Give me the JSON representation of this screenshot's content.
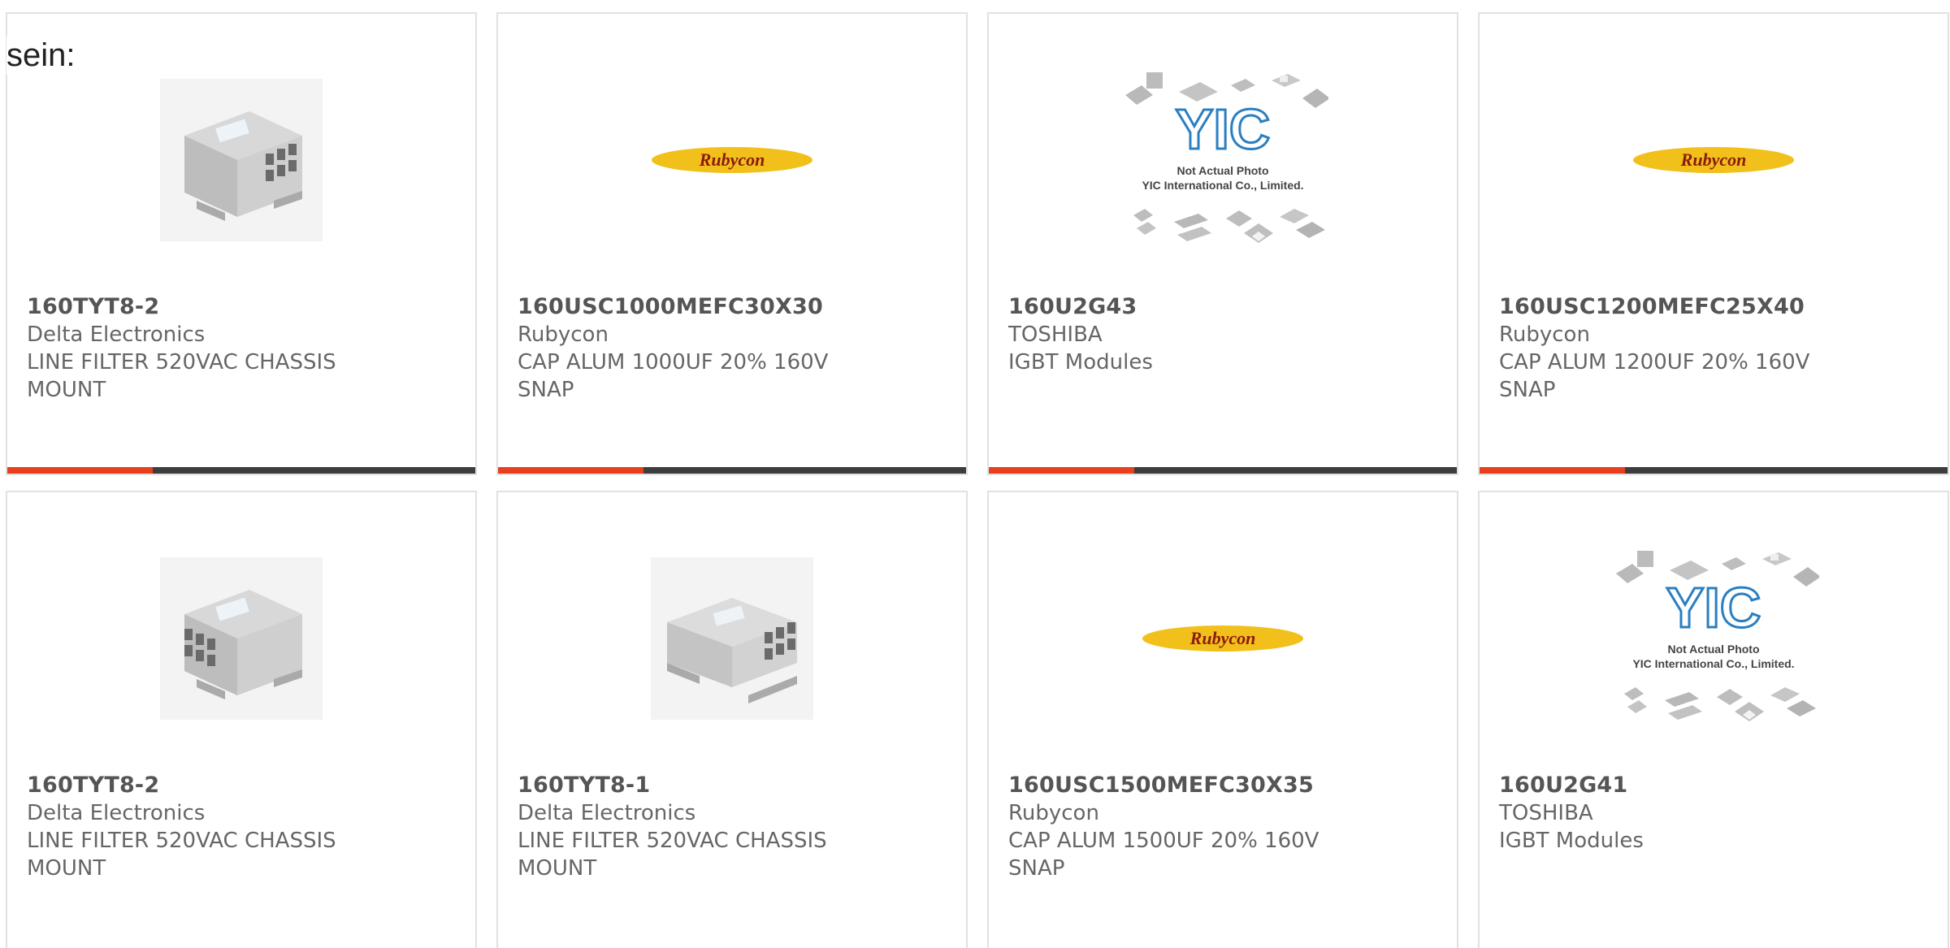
{
  "lead_text": "sein:",
  "colors": {
    "accent": "#e8401c",
    "track": "#3d3d3d",
    "logo_yellow": "#f2c01b",
    "logo_text": "#8a1a10",
    "yic_blue": "#2a7fc1"
  },
  "products": [
    {
      "part_number": "160TYT8-2",
      "manufacturer": "Delta Electronics",
      "description": "LINE FILTER 520VAC CHASSIS MOUNT",
      "image": "line-filter-photo",
      "progress": 0.31
    },
    {
      "part_number": "160USC1000MEFC30X30",
      "manufacturer": "Rubycon",
      "description": "CAP ALUM 1000UF 20% 160V SNAP",
      "image": "rubycon-logo",
      "progress": 0.31
    },
    {
      "part_number": "160U2G43",
      "manufacturer": "TOSHIBA",
      "description": "IGBT Modules",
      "image": "yic-placeholder",
      "progress": 0.31
    },
    {
      "part_number": "160USC1200MEFC25X40",
      "manufacturer": "Rubycon",
      "description": "CAP ALUM 1200UF 20% 160V SNAP",
      "image": "rubycon-logo",
      "progress": 0.31
    },
    {
      "part_number": "160TYT8-2",
      "manufacturer": "Delta Electronics",
      "description": "LINE FILTER 520VAC CHASSIS MOUNT",
      "image": "line-filter-photo"
    },
    {
      "part_number": "160TYT8-1",
      "manufacturer": "Delta Electronics",
      "description": "LINE FILTER 520VAC CHASSIS MOUNT",
      "image": "line-filter-photo"
    },
    {
      "part_number": "160USC1500MEFC30X35",
      "manufacturer": "Rubycon",
      "description": "CAP ALUM 1500UF 20% 160V SNAP",
      "image": "rubycon-logo"
    },
    {
      "part_number": "160U2G41",
      "manufacturer": "TOSHIBA",
      "description": "IGBT Modules",
      "image": "yic-placeholder"
    }
  ],
  "logo_text": {
    "rubycon": "Rubycon",
    "yic": "YIC",
    "yic_line1": "Not Actual Photo",
    "yic_line2": "YIC International Co., Limited."
  }
}
